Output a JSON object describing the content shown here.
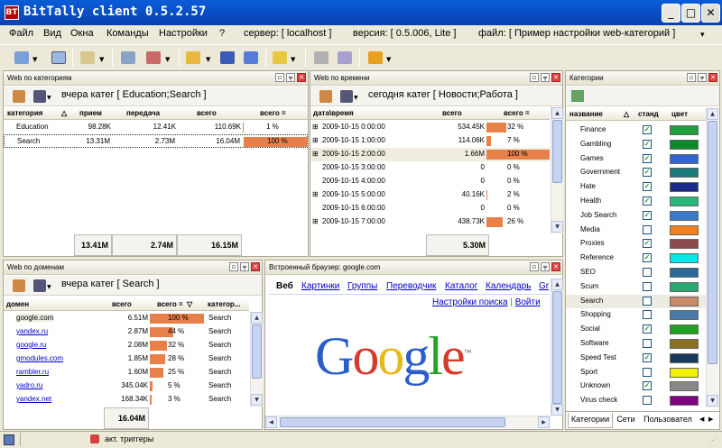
{
  "window": {
    "app_icon_text": "BT",
    "title": "BitTally client  0.5.2.57",
    "min": "_",
    "max": "□",
    "close": "✕"
  },
  "menu": {
    "items": [
      "Файл",
      "Вид",
      "Окна",
      "Команды",
      "Настройки",
      "?"
    ],
    "server": "сервер: [ localhost ]",
    "version": "версия: [ 0.5.006, Lite ]",
    "file": "файл: [ Пример настройки web-категорий ]",
    "file_arrow": "▾",
    "restore_icon": "⇗",
    "close_icon": "✕"
  },
  "colors": {
    "bar": "#e8804a",
    "title_bg": "#0a5cd8"
  },
  "panel_cat": {
    "title": "Web по категориям",
    "subtitle": "вчера  катег [ Education;Search ]",
    "headers": [
      "категория",
      "прием",
      "передача",
      "всего",
      "всего ="
    ],
    "rows": [
      {
        "name": "Education",
        "recv": "98.28K",
        "send": "12.41K",
        "total": "110.69K",
        "pct": "1 %",
        "frac": 0.01
      },
      {
        "name": "Search",
        "recv": "13.31M",
        "send": "2.73M",
        "total": "16.04M",
        "pct": "100 %",
        "frac": 1.0
      }
    ],
    "totals": [
      "13.41M",
      "2.74M",
      "16.15M"
    ]
  },
  "panel_time": {
    "title": "Web по времени",
    "subtitle": "сегодня  катег [ Новости;Работа ]",
    "headers": [
      "дата\\время",
      "всего",
      "всего ="
    ],
    "rows": [
      {
        "time": "2009-10-15  0:00:00",
        "total": "534.45K",
        "pct": "32 %",
        "frac": 0.32,
        "plus": "⊞"
      },
      {
        "time": "2009-10-15  1:00:00",
        "total": "114.06K",
        "pct": "7 %",
        "frac": 0.07,
        "plus": "⊞"
      },
      {
        "time": "2009-10-15  2:00:00",
        "total": "1.66M",
        "pct": "100 %",
        "frac": 1.0,
        "plus": "⊞"
      },
      {
        "time": "2009-10-15  3:00:00",
        "total": "0",
        "pct": "0 %",
        "frac": 0,
        "plus": ""
      },
      {
        "time": "2009-10-15  4:00:00",
        "total": "0",
        "pct": "0 %",
        "frac": 0,
        "plus": ""
      },
      {
        "time": "2009-10-15  5:00:00",
        "total": "40.16K",
        "pct": "2 %",
        "frac": 0.02,
        "plus": "⊞"
      },
      {
        "time": "2009-10-15  6:00:00",
        "total": "0",
        "pct": "0 %",
        "frac": 0,
        "plus": ""
      },
      {
        "time": "2009-10-15  7:00:00",
        "total": "438.73K",
        "pct": "26 %",
        "frac": 0.26,
        "plus": "⊞"
      }
    ],
    "total": "5.30M"
  },
  "panel_dom": {
    "title": "Web по доменам",
    "subtitle": "вчера  катег [ Search ]",
    "headers": [
      "домен",
      "всего",
      "всего =",
      "категор..."
    ],
    "rows": [
      {
        "domain": "google.com",
        "total": "6.51M",
        "pct": "100 %",
        "frac": 1.0,
        "cat": "Search"
      },
      {
        "domain": "yandex.ru",
        "total": "2.87M",
        "pct": "44 %",
        "frac": 0.44,
        "cat": "Search"
      },
      {
        "domain": "google.ru",
        "total": "2.08M",
        "pct": "32 %",
        "frac": 0.32,
        "cat": "Search"
      },
      {
        "domain": "gmodules.com",
        "total": "1.85M",
        "pct": "28 %",
        "frac": 0.28,
        "cat": "Search"
      },
      {
        "domain": "rambler.ru",
        "total": "1.60M",
        "pct": "25 %",
        "frac": 0.25,
        "cat": "Search"
      },
      {
        "domain": "yadro.ru",
        "total": "345.04K",
        "pct": "5 %",
        "frac": 0.05,
        "cat": "Search"
      },
      {
        "domain": "yandex.net",
        "total": "168.34K",
        "pct": "3 %",
        "frac": 0.03,
        "cat": "Search"
      }
    ],
    "total": "16.04M"
  },
  "browser": {
    "title": "Встроенный браузер: google.com",
    "nav": [
      "Веб",
      "Картинки",
      "Группы",
      "Переводчик",
      "Каталог",
      "Календарь",
      "Gr"
    ],
    "settings_link": "Настройки поиска",
    "sep": "|",
    "login_link": "Войти",
    "logo": [
      "G",
      "o",
      "o",
      "g",
      "l",
      "e"
    ],
    "tm": "™"
  },
  "categories": {
    "title": "Категории",
    "headers": [
      "название",
      "станд",
      "цвет"
    ],
    "items": [
      {
        "name": "Finance",
        "std": true,
        "color": "#1e9e3a"
      },
      {
        "name": "Gambling",
        "std": true,
        "color": "#0a8a28"
      },
      {
        "name": "Games",
        "std": true,
        "color": "#3366cc"
      },
      {
        "name": "Government",
        "std": true,
        "color": "#1a7a7a"
      },
      {
        "name": "Hate",
        "std": true,
        "color": "#1a2a8a"
      },
      {
        "name": "Health",
        "std": true,
        "color": "#28b878"
      },
      {
        "name": "Job Search",
        "std": true,
        "color": "#3a7ac8"
      },
      {
        "name": "Media",
        "std": false,
        "color": "#f08020"
      },
      {
        "name": "Proxies",
        "std": true,
        "color": "#8a4a4a"
      },
      {
        "name": "Reference",
        "std": true,
        "color": "#00e8e8"
      },
      {
        "name": "SEO",
        "std": false,
        "color": "#2a6a9a"
      },
      {
        "name": "Scum",
        "std": false,
        "color": "#2aa870"
      },
      {
        "name": "Search",
        "std": false,
        "color": "#c88a6a"
      },
      {
        "name": "Shopping",
        "std": false,
        "color": "#4a7aa8"
      },
      {
        "name": "Social",
        "std": true,
        "color": "#20a020"
      },
      {
        "name": "Software",
        "std": false,
        "color": "#8a7020"
      },
      {
        "name": "Speed Test",
        "std": true,
        "color": "#183a5a"
      },
      {
        "name": "Sport",
        "std": false,
        "color": "#f0f000"
      },
      {
        "name": "Unknown",
        "std": true,
        "color": "#888888"
      },
      {
        "name": "Virus check",
        "std": false,
        "color": "#800080"
      }
    ],
    "tabs": [
      "Категории",
      "Сети",
      "Пользовател"
    ]
  },
  "status": {
    "triggers": "акт. триггеры"
  }
}
